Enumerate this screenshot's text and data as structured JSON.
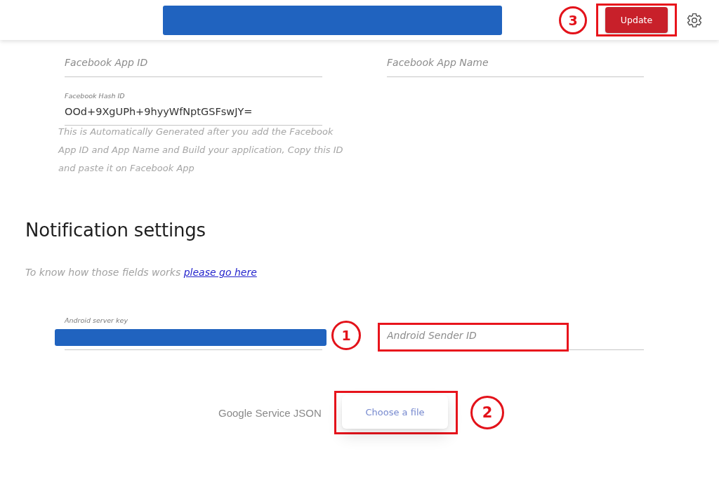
{
  "header": {
    "title_redacted": true,
    "update_button": {
      "label": "Update",
      "highlighted": true,
      "callout": "3"
    }
  },
  "facebook": {
    "fields": [
      {
        "placeholder": "Facebook App ID"
      },
      {
        "placeholder": "Facebook App Name"
      }
    ],
    "hash_field": {
      "label": "Facebook Hash ID",
      "value": "OOd+9XgUPh+9hyyWfNptGSFswJY=",
      "help": "This is Automatically Generated after you add the Facebook App ID and App Name and Build your application, Copy this ID and paste it on Facebook App"
    }
  },
  "notification_settings": {
    "heading": "Notification settings",
    "intro": "To know how those fields works",
    "link": "please go here",
    "fields": [
      {
        "kind": "labeled",
        "label": "Android server key",
        "redacted": true
      },
      {
        "kind": "placeholder",
        "placeholder": "Android Sender ID",
        "highlighted": true,
        "callout": "1"
      }
    ],
    "file_upload": {
      "label": "Google Service JSON",
      "button": "Choose a file",
      "highlighted": true,
      "callout": "2"
    }
  }
}
